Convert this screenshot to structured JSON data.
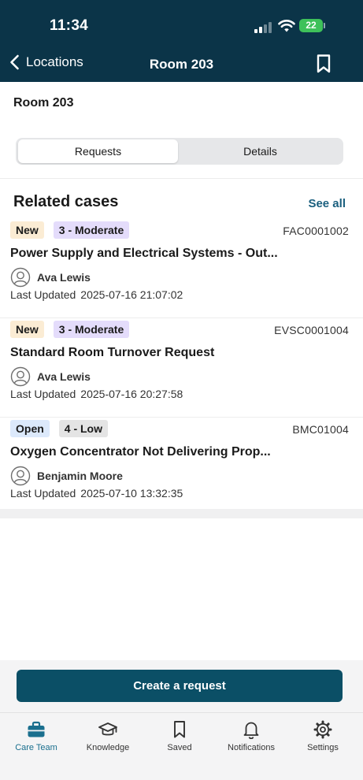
{
  "status_bar": {
    "time": "11:34",
    "battery": "22"
  },
  "nav": {
    "back_label": "Locations",
    "title": "Room 203"
  },
  "page": {
    "room_title": "Room 203"
  },
  "segments": {
    "requests": "Requests",
    "details": "Details",
    "selected": "Requests"
  },
  "related": {
    "title": "Related cases",
    "see_all": "See all",
    "updated_label": "Last Updated",
    "cases": [
      {
        "status": "New",
        "priority": "3 - Moderate",
        "number": "FAC0001002",
        "title": "Power Supply and Electrical Systems - Out...",
        "person": "Ava Lewis",
        "updated": "2025-07-16 21:07:02"
      },
      {
        "status": "New",
        "priority": "3 - Moderate",
        "number": "EVSC0001004",
        "title": "Standard Room Turnover Request",
        "person": "Ava Lewis",
        "updated": "2025-07-16 20:27:58"
      },
      {
        "status": "Open",
        "priority": "4 - Low",
        "number": "BMC01004",
        "title": "Oxygen Concentrator Not Delivering Prop...",
        "person": "Benjamin Moore",
        "updated": "2025-07-10 13:32:35"
      }
    ]
  },
  "actions": {
    "create_request": "Create a request"
  },
  "tabbar": {
    "items": [
      {
        "label": "Care Team",
        "icon": "briefcase-icon",
        "active": true
      },
      {
        "label": "Knowledge",
        "icon": "graduation-cap-icon",
        "active": false
      },
      {
        "label": "Saved",
        "icon": "bookmark-icon",
        "active": false
      },
      {
        "label": "Notifications",
        "icon": "bell-icon",
        "active": false
      },
      {
        "label": "Settings",
        "icon": "gear-icon",
        "active": false
      }
    ]
  },
  "colors": {
    "header_bg": "#0b3448",
    "primary_button": "#0b4f66",
    "accent": "#1a6f8e",
    "badge_new": "#fbecd4",
    "badge_open": "#dce9fb",
    "badge_moderate": "#e4dcfb",
    "badge_low": "#e4e4e4",
    "battery": "#3ec15a"
  }
}
